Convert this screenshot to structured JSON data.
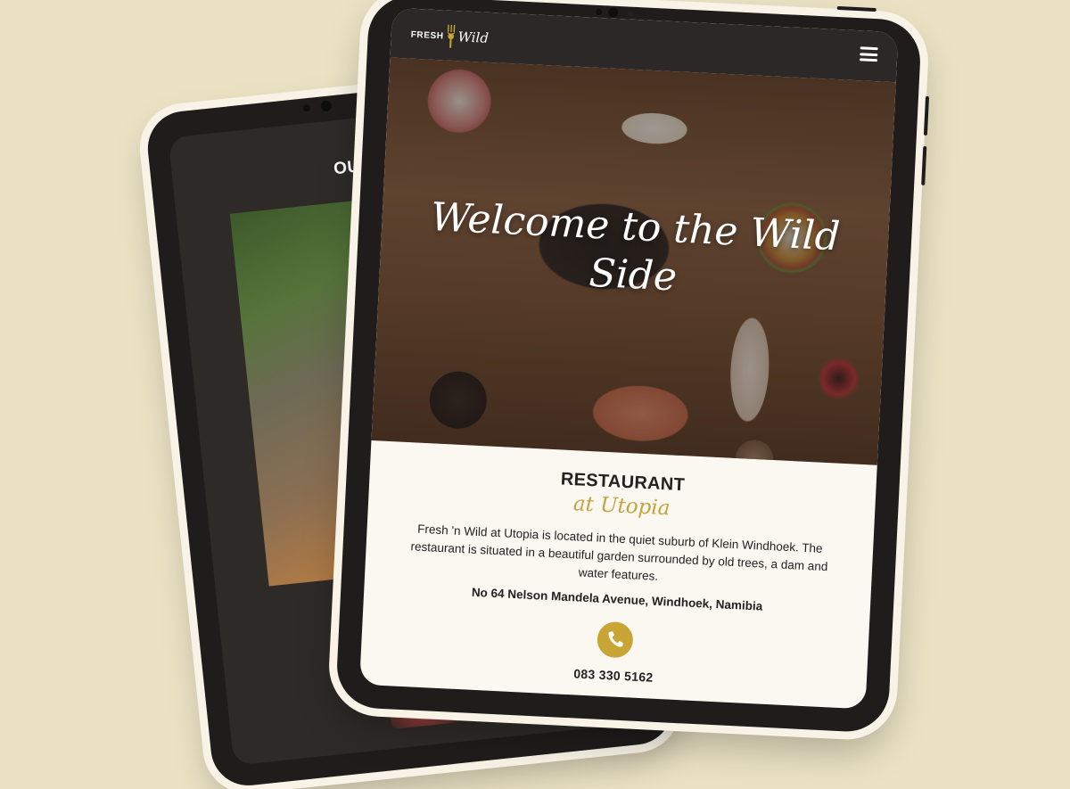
{
  "colors": {
    "background": "#ebe2c4",
    "device": "#1f1c1b",
    "accent_gold": "#c8a535",
    "content_bg": "#faf8f1"
  },
  "back_tablet": {
    "section_title": "OUR UTOPI"
  },
  "front_tablet": {
    "logo": {
      "word_left": "FRESH",
      "word_right": "Wild",
      "icon": "fork-icon"
    },
    "menu_icon": "hamburger-menu-icon",
    "hero": {
      "title": "Welcome to the Wild Side"
    },
    "about": {
      "title": "RESTAURANT",
      "subtitle": "at Utopia",
      "description": "Fresh 'n Wild at Utopia is located in the quiet suburb of Klein Windhoek. The restaurant is situated in a beautiful garden surrounded by old trees, a dam and water features.",
      "address": "No 64 Nelson Mandela Avenue, Windhoek, Namibia",
      "phone_icon": "phone-icon",
      "phone": "083 330 5162"
    }
  }
}
